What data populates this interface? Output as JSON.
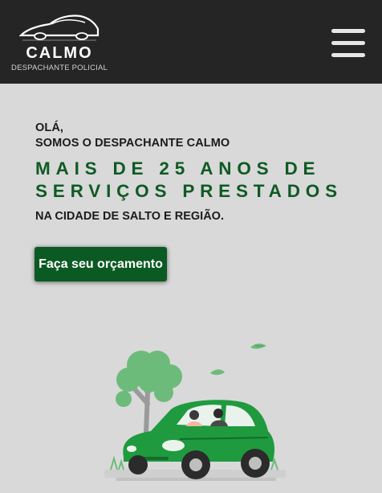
{
  "navbar": {
    "brand_name": "CALMO",
    "brand_tagline": "DESPACHANTE POLICIAL",
    "logo_icon": "car-silhouette-icon",
    "menu_icon": "hamburger-menu-icon"
  },
  "hero": {
    "greeting_line1": "OLÁ,",
    "greeting_line2": "SOMOS O DESPACHANTE CALMO",
    "headline_line1": "MAIS DE 25 ANOS DE",
    "headline_line2": "SERVIÇOS PRESTADOS",
    "region": "NA CIDADE DE SALTO E REGIÃO.",
    "cta_label": "Faça seu orçamento"
  },
  "colors": {
    "navbar_background": "#252525",
    "page_background": "#d9d9d9",
    "brand_green": "#0f5a24",
    "button_green": "#0c5a23",
    "car_green": "#1f9a3f",
    "tree_green": "#6dbb7a"
  }
}
